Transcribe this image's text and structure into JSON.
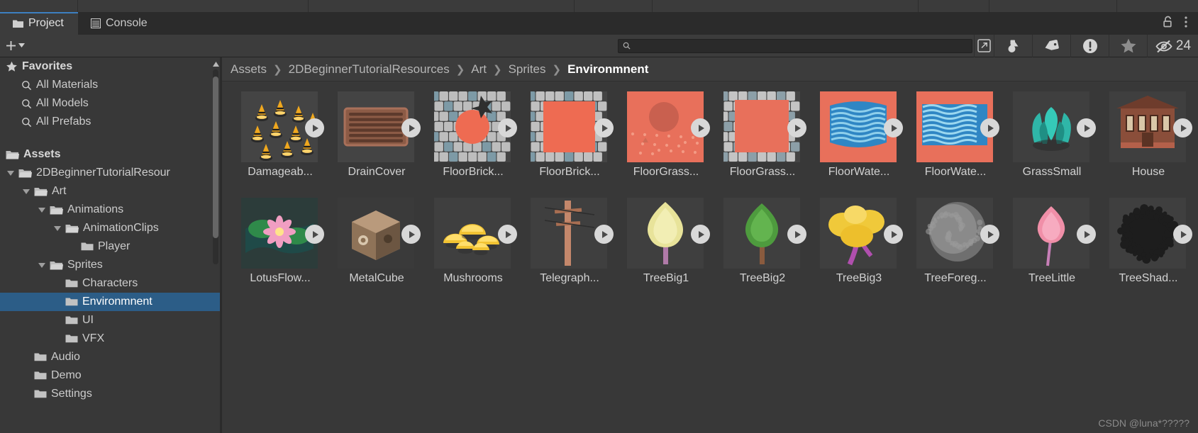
{
  "window": {
    "tabs": [
      {
        "label": "Project",
        "icon": "folder-icon",
        "active": true
      },
      {
        "label": "Console",
        "icon": "console-icon",
        "active": false
      }
    ],
    "lock_icon": "lock-open-icon",
    "menu_icon": "kebab-menu-icon"
  },
  "toolbar": {
    "create_label": "+",
    "create_caret": "▾",
    "search": {
      "value": "",
      "placeholder": "",
      "icon": "search-icon"
    },
    "expand_icon": "search-expand-icon",
    "filters": [
      {
        "name": "filter-by-type-icon",
        "label": ""
      },
      {
        "name": "filter-by-label-icon",
        "label": ""
      },
      {
        "name": "filter-warning-icon",
        "label": ""
      },
      {
        "name": "filter-favorite-star-icon",
        "label": ""
      }
    ],
    "hidden_toggle": {
      "icon": "eye-slash-icon",
      "count": "24"
    }
  },
  "tree": {
    "favorites": {
      "label": "Favorites",
      "icon": "star-icon",
      "items": [
        {
          "label": "All Materials",
          "icon": "search-icon"
        },
        {
          "label": "All Models",
          "icon": "search-icon"
        },
        {
          "label": "All Prefabs",
          "icon": "search-icon"
        }
      ]
    },
    "assets": {
      "label": "Assets",
      "icon": "folder-open-icon",
      "nodes": [
        {
          "label": "2DBeginnerTutorialResour",
          "depth": 1,
          "expanded": true,
          "open": true
        },
        {
          "label": "Art",
          "depth": 2,
          "expanded": true,
          "open": true
        },
        {
          "label": "Animations",
          "depth": 3,
          "expanded": true,
          "open": true
        },
        {
          "label": "AnimationClips",
          "depth": 4,
          "expanded": true,
          "open": true
        },
        {
          "label": "Player",
          "depth": 5,
          "expanded": false,
          "open": false
        },
        {
          "label": "Sprites",
          "depth": 3,
          "expanded": true,
          "open": true
        },
        {
          "label": "Characters",
          "depth": 4,
          "expanded": false,
          "open": false
        },
        {
          "label": "Environmnent",
          "depth": 4,
          "expanded": false,
          "open": false,
          "selected": true
        },
        {
          "label": "UI",
          "depth": 4,
          "expanded": false,
          "open": false
        },
        {
          "label": "VFX",
          "depth": 4,
          "expanded": false,
          "open": false
        },
        {
          "label": "Audio",
          "depth": 2,
          "expanded": false,
          "open": false
        },
        {
          "label": "Demo",
          "depth": 2,
          "expanded": false,
          "open": false
        },
        {
          "label": "Settings",
          "depth": 2,
          "expanded": false,
          "open": false
        }
      ]
    }
  },
  "breadcrumb": {
    "crumbs": [
      "Assets",
      "2DBeginnerTutorialResources",
      "Art",
      "Sprites",
      "Environmnent"
    ],
    "separator": "❯"
  },
  "grid": {
    "items": [
      {
        "label": "Damageab...",
        "art": "barrels"
      },
      {
        "label": "DrainCover",
        "art": "draincover"
      },
      {
        "label": "FloorBrick...",
        "art": "floorbrick-circle"
      },
      {
        "label": "FloorBrick...",
        "art": "floorbrick-square"
      },
      {
        "label": "FloorGrass...",
        "art": "floorgrass-circle"
      },
      {
        "label": "FloorGrass...",
        "art": "floorgrass-square"
      },
      {
        "label": "FloorWate...",
        "art": "floorwater-round"
      },
      {
        "label": "FloorWate...",
        "art": "floorwater-square"
      },
      {
        "label": "GrassSmall",
        "art": "grasssmall"
      },
      {
        "label": "House",
        "art": "house"
      },
      {
        "label": "LotusFlow...",
        "art": "lotusflower"
      },
      {
        "label": "MetalCube",
        "art": "metalcube"
      },
      {
        "label": "Mushrooms",
        "art": "mushrooms"
      },
      {
        "label": "Telegraph...",
        "art": "telegraphpole"
      },
      {
        "label": "TreeBig1",
        "art": "treebig1"
      },
      {
        "label": "TreeBig2",
        "art": "treebig2"
      },
      {
        "label": "TreeBig3",
        "art": "treebig3"
      },
      {
        "label": "TreeForeg...",
        "art": "treeforeground"
      },
      {
        "label": "TreeLittle",
        "art": "treelittle"
      },
      {
        "label": "TreeShad...",
        "art": "treeshadow"
      }
    ]
  },
  "watermark": "CSDN @luna*?????",
  "colors": {
    "selection_blue": "#2c5d87",
    "tab_accent": "#3d7fc1",
    "panel_bg": "#383838",
    "toolbar_bg": "#3c3c3c"
  }
}
